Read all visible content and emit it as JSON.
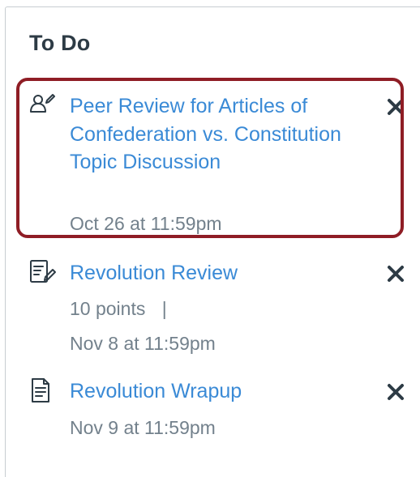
{
  "todo": {
    "title": "To Do",
    "items": [
      {
        "icon": "peer-review-icon",
        "title": "Peer Review for Articles of Confederation vs. Constitution Topic Discussion",
        "due": "Oct 26 at 11:59pm"
      },
      {
        "icon": "assignment-icon",
        "title": "Revolution Review",
        "points": "10 points",
        "separator": "|",
        "due": "Nov 8 at 11:59pm"
      },
      {
        "icon": "document-icon",
        "title": "Revolution Wrapup",
        "due": "Nov 9 at 11:59pm"
      }
    ]
  },
  "colors": {
    "link": "#3a8ad6",
    "heading": "#2d3b45",
    "meta": "#73818c",
    "highlight_border": "#8f1d25"
  }
}
